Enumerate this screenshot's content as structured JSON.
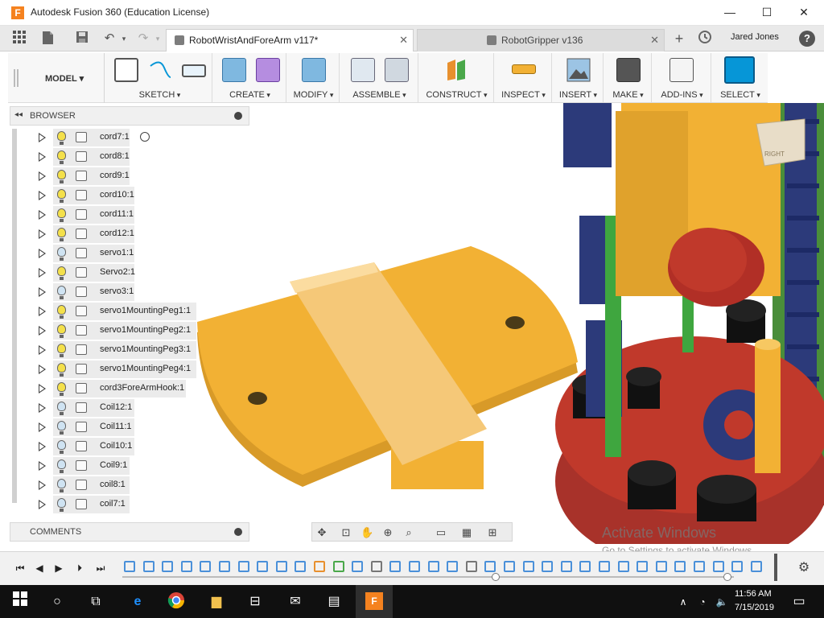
{
  "window": {
    "title": "Autodesk Fusion 360 (Education License)",
    "minimize": "—",
    "maximize": "☐",
    "close": "✕"
  },
  "tabs": [
    {
      "label": "RobotWristAndForeArm v117*",
      "close": "✕"
    },
    {
      "label": "RobotGripper v136",
      "close": "✕"
    }
  ],
  "tabbar": {
    "user": "Jared Jones",
    "help": "?",
    "new_tab": "+"
  },
  "toolbar": {
    "workspace": "MODEL ▾",
    "groups": [
      {
        "label": "SKETCH"
      },
      {
        "label": "CREATE"
      },
      {
        "label": "MODIFY"
      },
      {
        "label": "ASSEMBLE"
      },
      {
        "label": "CONSTRUCT"
      },
      {
        "label": "INSPECT"
      },
      {
        "label": "INSERT"
      },
      {
        "label": "MAKE"
      },
      {
        "label": "ADD-INS"
      },
      {
        "label": "SELECT"
      }
    ]
  },
  "browser": {
    "title": "BROWSER",
    "collapse": "◂◂",
    "items": [
      {
        "label": "cord7:1"
      },
      {
        "label": "cord8:1"
      },
      {
        "label": "cord9:1"
      },
      {
        "label": "cord10:1"
      },
      {
        "label": "cord11:1"
      },
      {
        "label": "cord12:1"
      },
      {
        "label": "servo1:1"
      },
      {
        "label": "Servo2:1"
      },
      {
        "label": "servo3:1"
      },
      {
        "label": "servo1MountingPeg1:1"
      },
      {
        "label": "servo1MountingPeg2:1"
      },
      {
        "label": "servo1MountingPeg3:1"
      },
      {
        "label": "servo1MountingPeg4:1"
      },
      {
        "label": "cord3ForeArmHook:1"
      },
      {
        "label": "Coil12:1"
      },
      {
        "label": "Coil11:1"
      },
      {
        "label": "Coil10:1"
      },
      {
        "label": "Coil9:1"
      },
      {
        "label": "coil8:1"
      },
      {
        "label": "coil7:1"
      }
    ]
  },
  "comments": {
    "title": "COMMENTS"
  },
  "viewcube": {
    "label": "RIGHT"
  },
  "watermark": {
    "title": "Activate Windows",
    "subtitle": "Go to Settings to activate Windows."
  },
  "taskbar": {
    "time": "11:56 AM",
    "date": "7/15/2019"
  },
  "colors": {
    "accent": "#0696d7",
    "part_orange": "#f2b134",
    "part_red": "#c0392b",
    "part_navy": "#2c3a7a",
    "part_green": "#3fa63f"
  }
}
